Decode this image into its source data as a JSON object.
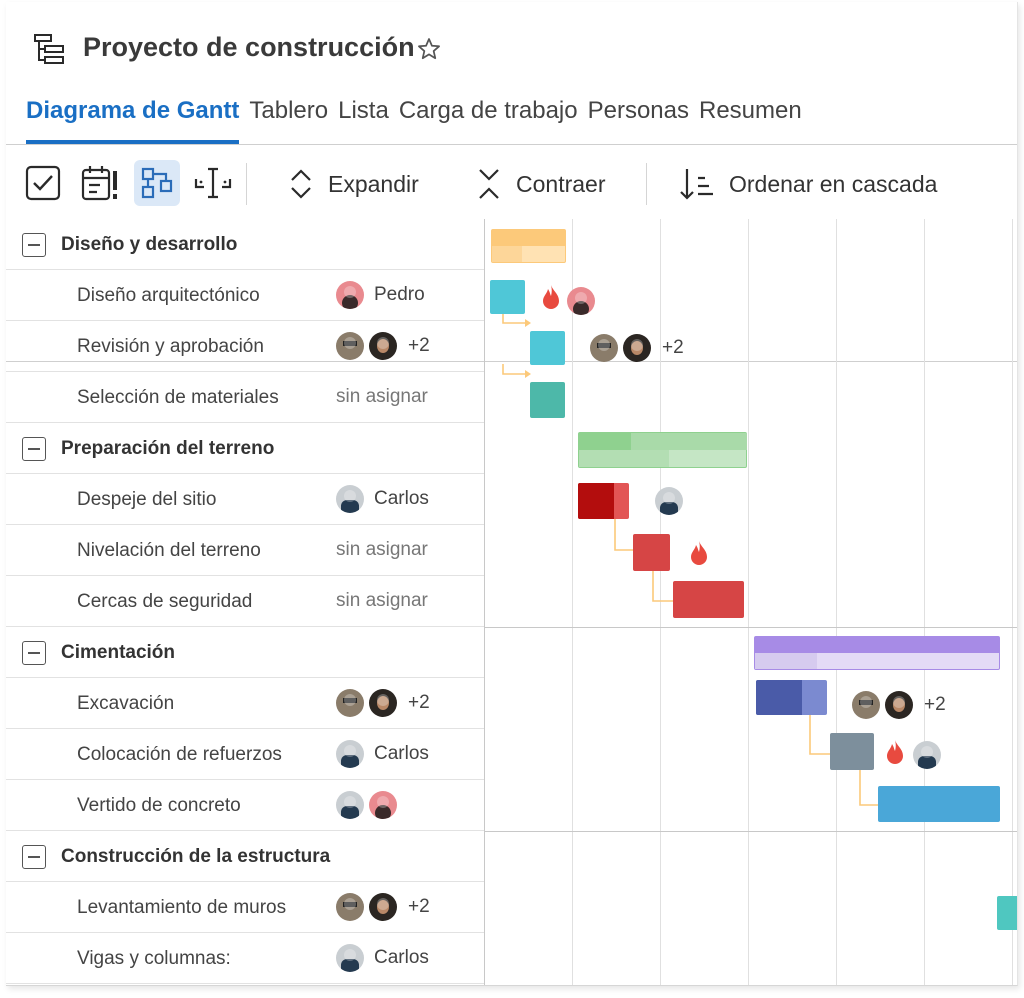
{
  "project": {
    "title": "Proyecto de construcción",
    "icon": "tree-structure-icon",
    "favorite_icon": "star-outline-icon"
  },
  "tabs": [
    {
      "label": "Diagrama de Gantt",
      "active": true
    },
    {
      "label": "Tablero",
      "active": false
    },
    {
      "label": "Lista",
      "active": false
    },
    {
      "label": "Carga de trabajo",
      "active": false
    },
    {
      "label": "Personas",
      "active": false
    },
    {
      "label": "Resumen",
      "active": false
    }
  ],
  "toolbar": {
    "icons": [
      "checkbox-icon",
      "calendar-alert-icon",
      "hierarchy-icon",
      "fit-width-icon"
    ],
    "expand_label": "Expandir",
    "collapse_label": "Contraer",
    "cascade_label": "Ordenar en cascada"
  },
  "groups": [
    {
      "name": "Diseño y desarrollo",
      "tasks": [
        {
          "name": "Diseño arquitectónico",
          "assignee": "Pedro"
        },
        {
          "name": "Revisión y aprobación",
          "more": "+2"
        },
        {
          "name": "Selección de materiales",
          "unassigned": "sin asignar"
        }
      ]
    },
    {
      "name": "Preparación del terreno",
      "tasks": [
        {
          "name": "Despeje del sitio",
          "assignee": "Carlos"
        },
        {
          "name": "Nivelación del terreno",
          "unassigned": "sin asignar"
        },
        {
          "name": "Cercas de seguridad",
          "unassigned": "sin asignar"
        }
      ]
    },
    {
      "name": "Cimentación",
      "tasks": [
        {
          "name": "Excavación",
          "more": "+2"
        },
        {
          "name": "Colocación de refuerzos",
          "assignee": "Carlos"
        },
        {
          "name": "Vertido de concreto"
        }
      ]
    },
    {
      "name": "Construcción de la estructura",
      "tasks": [
        {
          "name": "Levantamiento de muros",
          "more": "+2"
        },
        {
          "name": "Vigas y columnas:",
          "assignee": "Carlos"
        }
      ]
    }
  ],
  "timeline": {
    "more_review": "+2",
    "more_excavation": "+2",
    "colors": {
      "design_group": "#fcc97a",
      "design_task": "#4fc7d7",
      "terrain_group": "#8fd18f",
      "terrain_task": "#d64545",
      "foundation_group": "#a78be6",
      "excavation": "#4a5ba8",
      "rebar": "#7d8f9c",
      "concrete": "#4aa7d8",
      "dependency": "#fcc97a",
      "accent": "#1a6fc4"
    }
  }
}
